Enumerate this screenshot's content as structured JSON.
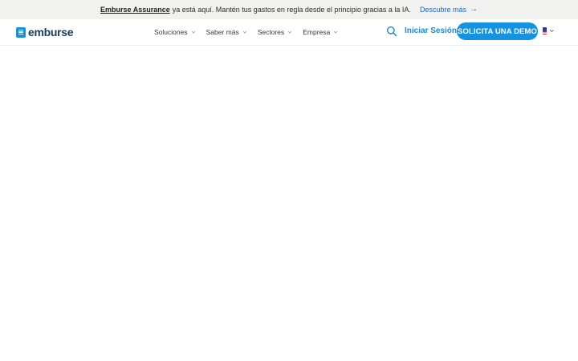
{
  "announcement": {
    "brand": "Emburse Assurance",
    "message": "ya está aquí. Mantén tus gastos en regla desde el principio gracias a la IA.",
    "cta_label": "Descubre más",
    "cta_icon": "arrow-right-icon"
  },
  "header": {
    "logo_text": "emburse",
    "menu": [
      {
        "label": "Soluciones",
        "icon": "chevron-down-icon"
      },
      {
        "label": "Saber más",
        "icon": "chevron-down-icon"
      },
      {
        "label": "Sectores",
        "icon": "chevron-down-icon"
      },
      {
        "label": "Empresa",
        "icon": "chevron-down-icon"
      }
    ],
    "search_icon": "search-icon",
    "login_label": "Iniciar Sesión",
    "demo_label": "SOLICITA UNA DEMO",
    "language_icon": "us-flag-icon"
  },
  "colors": {
    "brand_blue": "#1592e0",
    "link_blue": "#2a67b4",
    "banner_bg": "#f1f1ef",
    "logo_text": "#183b5a"
  }
}
